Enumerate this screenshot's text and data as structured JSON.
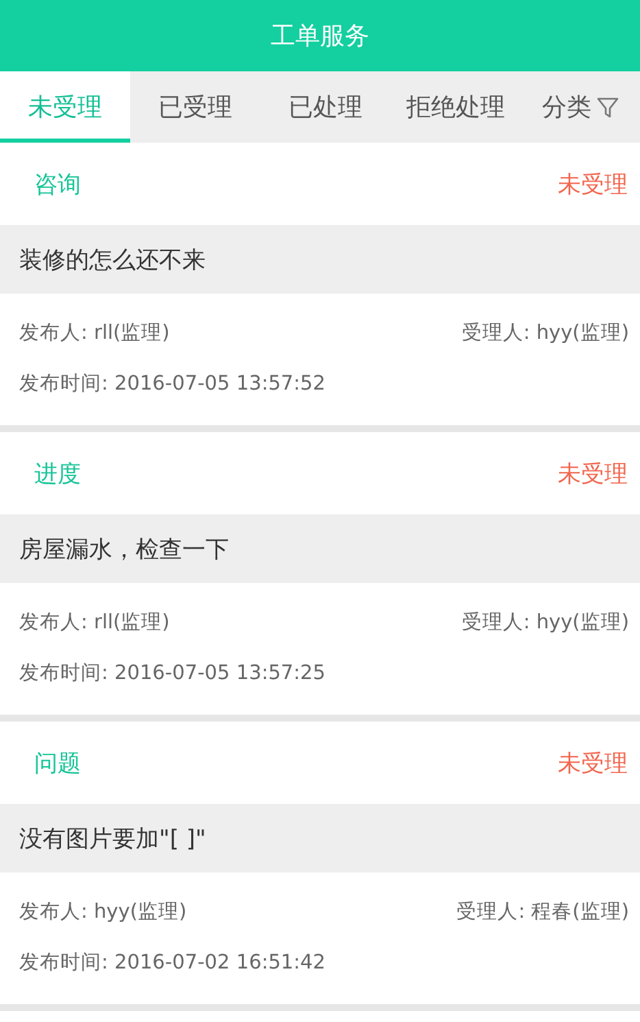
{
  "header": {
    "title": "工单服务"
  },
  "tabs": [
    {
      "label": "未受理",
      "selected": true
    },
    {
      "label": "已受理",
      "selected": false
    },
    {
      "label": "已处理",
      "selected": false
    },
    {
      "label": "拒绝处理",
      "selected": false
    },
    {
      "label": "分类",
      "selected": false,
      "kind": "filter"
    }
  ],
  "orders": [
    {
      "category": "咨询",
      "status": "未受理",
      "title": "装修的怎么还不来",
      "publisher": "发布人: rll(监理)",
      "handler": "受理人: hyy(监理)",
      "time": "发布时间: 2016-07-05 13:57:52"
    },
    {
      "category": "进度",
      "status": "未受理",
      "title": "房屋漏水，检查一下",
      "publisher": "发布人: rll(监理)",
      "handler": "受理人: hyy(监理)",
      "time": "发布时间: 2016-07-05 13:57:25"
    },
    {
      "category": "问题",
      "status": "未受理",
      "title": "没有图片要加\"[ ]\"",
      "publisher": "发布人: hyy(监理)",
      "handler": "受理人: 程春(监理)",
      "time": "发布时间: 2016-07-02 16:51:42"
    }
  ]
}
